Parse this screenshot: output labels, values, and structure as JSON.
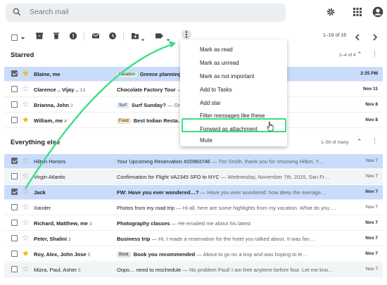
{
  "search": {
    "placeholder": "Search mail"
  },
  "toolbar": {
    "range": "1–16 of 16"
  },
  "sections": {
    "starred": {
      "title": "Starred",
      "count": "1–4 of 4"
    },
    "everything": {
      "title": "Everything else",
      "count": "1–50 of many"
    }
  },
  "starred_rows": [
    {
      "sender": "Blaine, me",
      "label": "Vacation",
      "subject": "Greece planning",
      "snippet": "… in Santorini for the …",
      "date": "2:25 PM",
      "selected": true,
      "starred": true,
      "unread": true
    },
    {
      "sender": "Clarence .. Vijay ..",
      "count": "13",
      "subject": "Chocolate Factory Tour",
      "snippet": " — … Factory! The tour begins",
      "date": "Nov 11",
      "unread": true
    },
    {
      "sender": "Brianna, John",
      "count": "2",
      "label": "Surf",
      "subject": "Surf Sunday?",
      "snippet": " — Great …",
      "date": "Nov 8",
      "unread": true
    },
    {
      "sender": "William, me",
      "count": "4",
      "label": "Food",
      "subject": "Best Indian Resta…",
      "snippet": "… Indian places in the …",
      "date": "Nov 8",
      "starred": true,
      "unread": true
    }
  ],
  "other_rows": [
    {
      "sender": "Hilton Honors",
      "subject": "Your Upcoming Reservation #20983746",
      "snippet": " — Tim Smith, thank you for choosing Hilton. Y…",
      "date": "Nov 7",
      "selected": true
    },
    {
      "sender": "Virgin Atlantic",
      "subject": "Confirmation for Flight VA2345 SFO to NYC",
      "snippet": " — Wednesday, November 7th, 2015, San Fr…",
      "date": "Nov 7",
      "read": true
    },
    {
      "sender": "Jack",
      "subject": "FW: Have you ever wondered…?",
      "snippet": " — Have you ever wondered: how deep the average…",
      "date": "Nov 7",
      "selected": true,
      "unread": true
    },
    {
      "sender": "Xander",
      "subject": "Photos from my road trip",
      "snippet": " — Hi all, here are some highlights from my vacation. What do you …",
      "date": "Nov 7"
    },
    {
      "sender": "Richard, Matthew, me",
      "count": "3",
      "subject": "Photography classes",
      "snippet": " — He emailed me about his latest",
      "date": "Nov 7",
      "unread": true
    },
    {
      "sender": "Peter, Shalini",
      "count": "2",
      "subject": "Business trip",
      "snippet": " — Hi, I made a reservation for the hotel you talked about. It was fan…",
      "date": "Nov 7",
      "unread": true
    },
    {
      "sender": "Roy, Alex, John Jose",
      "count": "5",
      "label": "Book",
      "subject": "Book you recommended",
      "snippet": " — About to go on a trop and was hoping to le…",
      "date": "Nov 7",
      "starred": true,
      "unread": true
    },
    {
      "sender": "Mizra, Paul, Asher",
      "count": "5",
      "subject": "Oops… need to reschedule",
      "snippet": " — No problem Paul! I am free anytime before four. Let me kno…",
      "date": "Nov 7",
      "read": true
    }
  ],
  "menu": {
    "items": [
      "Mark as read",
      "Mark as unread",
      "Mark as not important",
      "Add to Tasks",
      "Add star",
      "Filter messages like these",
      "Forward as attachment",
      "Mute"
    ]
  },
  "colors": {
    "selected_row": "#c9dcfb",
    "star": "#f4b400",
    "highlight_box": "#3ddc84",
    "arrow": "#3ddc84",
    "label_vacation": "#d7f3de",
    "label_surf": "#e4ecfb",
    "label_food": "#fde3c3",
    "label_book": "#e3e3e3"
  },
  "icons": {
    "search": "search-icon",
    "settings": "gear-icon",
    "apps": "apps-grid-icon",
    "account": "account-icon",
    "archive": "archive-icon",
    "delete": "trash-icon",
    "spam": "report-spam-icon",
    "mark": "envelope-icon",
    "snooze": "clock-icon",
    "move": "move-to-icon",
    "labels": "label-icon",
    "more": "more-vert-icon"
  }
}
